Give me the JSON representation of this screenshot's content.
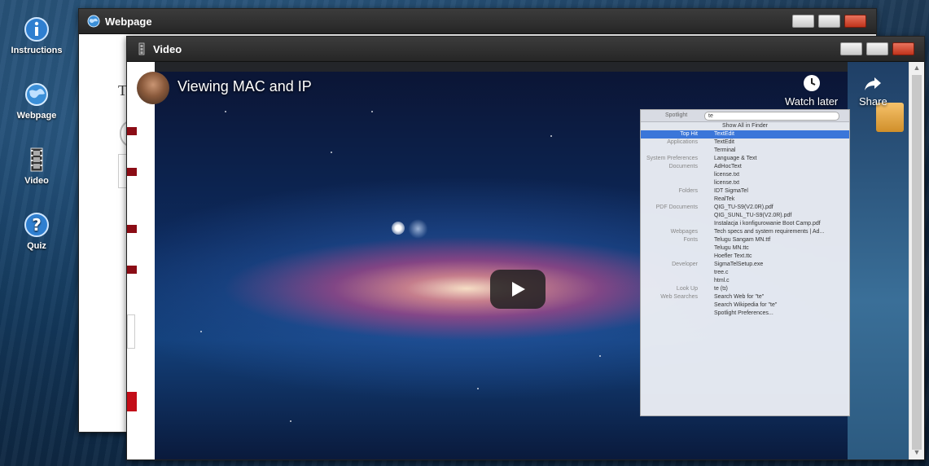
{
  "desktop": {
    "icons": [
      {
        "label": "Instructions",
        "icon": "info-icon"
      },
      {
        "label": "Webpage",
        "icon": "globe-icon"
      },
      {
        "label": "Video",
        "icon": "film-icon"
      },
      {
        "label": "Quiz",
        "icon": "question-icon"
      }
    ]
  },
  "webpage_window": {
    "title": "Webpage",
    "partial_text": "T"
  },
  "video_window": {
    "title": "Video",
    "youtube": {
      "video_title": "Viewing MAC and IP",
      "watch_later": "Watch later",
      "share": "Share"
    }
  },
  "spotlight": {
    "search_label": "Spotlight",
    "query": "te",
    "rows": [
      {
        "cat": "",
        "item": "Show All in Finder"
      },
      {
        "cat": "Top Hit",
        "item": "TextEdit",
        "selected": true
      },
      {
        "cat": "Applications",
        "item": "TextEdit"
      },
      {
        "cat": "",
        "item": "Terminal"
      },
      {
        "cat": "System Preferences",
        "item": "Language & Text"
      },
      {
        "cat": "Documents",
        "item": "AdHocText"
      },
      {
        "cat": "",
        "item": "license.txt"
      },
      {
        "cat": "",
        "item": "license.txt"
      },
      {
        "cat": "Folders",
        "item": "IDT SigmaTel"
      },
      {
        "cat": "",
        "item": "RealTek"
      },
      {
        "cat": "PDF Documents",
        "item": "QIG_TU-S9(V2.0R).pdf"
      },
      {
        "cat": "",
        "item": "QIG_SUNL_TU-S9(V2.0R).pdf"
      },
      {
        "cat": "",
        "item": "Instalacja i konfigurowanie Boot Camp.pdf"
      },
      {
        "cat": "Webpages",
        "item": "Tech specs and system requirements | Ad..."
      },
      {
        "cat": "Fonts",
        "item": "Telugu Sangam MN.ttf"
      },
      {
        "cat": "",
        "item": "Telugu MN.ttc"
      },
      {
        "cat": "",
        "item": "Hoefler Text.ttc"
      },
      {
        "cat": "Developer",
        "item": "SigmaTelSetup.exe"
      },
      {
        "cat": "",
        "item": "tree.c"
      },
      {
        "cat": "",
        "item": "html.c"
      },
      {
        "cat": "Look Up",
        "item": "te (tɪ)"
      },
      {
        "cat": "Web Searches",
        "item": "Search Web for \"te\""
      },
      {
        "cat": "",
        "item": "Search Wikipedia for \"te\""
      },
      {
        "cat": "",
        "item": "Spotlight Preferences..."
      }
    ]
  },
  "colors": {
    "titlebar": "#2e2e2e",
    "close_button": "#c0341c",
    "spotlight_selection": "#3b76d9",
    "play_button": "#212121"
  }
}
